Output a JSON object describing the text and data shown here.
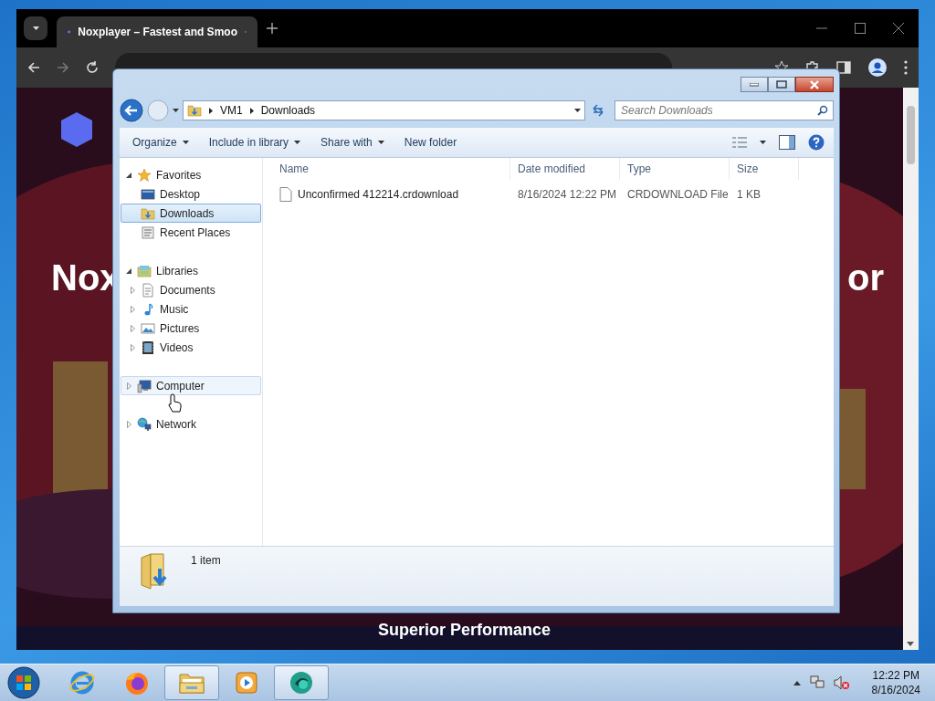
{
  "browser": {
    "tab_title": "Noxplayer – Fastest and Smoo",
    "page": {
      "headline_left": "Nox",
      "headline_right": "or",
      "feature": "Superior Performance"
    }
  },
  "explorer": {
    "breadcrumb": [
      "VM1",
      "Downloads"
    ],
    "search": {
      "placeholder": "Search Downloads"
    },
    "toolbar": [
      {
        "label": "Organize",
        "dropdown": true
      },
      {
        "label": "Include in library",
        "dropdown": true
      },
      {
        "label": "Share with",
        "dropdown": true
      },
      {
        "label": "New folder",
        "dropdown": false
      }
    ],
    "nav": [
      {
        "label": "Favorites",
        "kind": "star",
        "expanded": true,
        "selected": false,
        "hovered": false,
        "children": [
          {
            "label": "Desktop",
            "kind": "desktop",
            "selected": false,
            "hovered": false
          },
          {
            "label": "Downloads",
            "kind": "downloads",
            "selected": true,
            "hovered": false
          },
          {
            "label": "Recent Places",
            "kind": "recent",
            "selected": false,
            "hovered": false
          }
        ]
      },
      {
        "label": "Libraries",
        "kind": "library",
        "expanded": true,
        "selected": false,
        "hovered": false,
        "children": [
          {
            "label": "Documents",
            "kind": "documents",
            "expanded": false,
            "selected": false,
            "hovered": false
          },
          {
            "label": "Music",
            "kind": "music",
            "expanded": false,
            "selected": false,
            "hovered": false
          },
          {
            "label": "Pictures",
            "kind": "pictures",
            "expanded": false,
            "selected": false,
            "hovered": false
          },
          {
            "label": "Videos",
            "kind": "videos",
            "expanded": false,
            "selected": false,
            "hovered": false
          }
        ]
      },
      {
        "label": "Computer",
        "kind": "computer",
        "expanded": false,
        "selected": false,
        "hovered": true
      },
      {
        "label": "Network",
        "kind": "network",
        "expanded": false,
        "selected": false,
        "hovered": false
      }
    ],
    "columns": [
      "Name",
      "Date modified",
      "Type",
      "Size"
    ],
    "files": [
      {
        "name": "Unconfirmed 412214.crdownload",
        "date": "8/16/2024 12:22 PM",
        "type": "CRDOWNLOAD File",
        "size": "1 KB"
      }
    ],
    "details": {
      "count": "1 item"
    }
  },
  "taskbar": {
    "apps": [
      {
        "kind": "ie",
        "active": false
      },
      {
        "kind": "firefox",
        "active": false
      },
      {
        "kind": "explorer",
        "active": true
      },
      {
        "kind": "media",
        "active": false
      },
      {
        "kind": "nox",
        "active": true
      }
    ],
    "clock": {
      "time": "12:22 PM",
      "date": "8/16/2024"
    }
  }
}
